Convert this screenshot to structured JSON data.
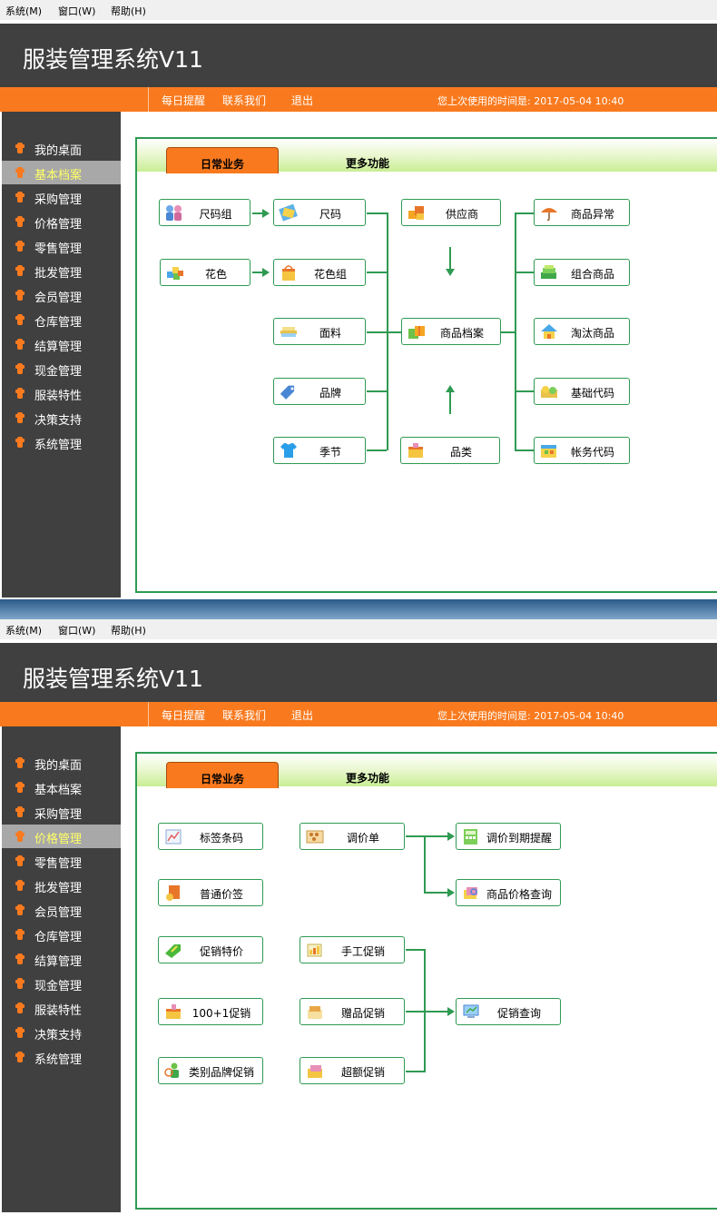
{
  "menu": {
    "system": "系统(M)",
    "window": "窗口(W)",
    "help": "帮助(H)"
  },
  "app_title": "服装管理系统V11",
  "topnav": {
    "daily_reminder": "每日提醒",
    "contact": "联系我们",
    "logout": "退出",
    "last_used": "您上次使用的时间是: 2017-05-04 10:40"
  },
  "sidebar": [
    "我的桌面",
    "基本档案",
    "采购管理",
    "价格管理",
    "零售管理",
    "批发管理",
    "会员管理",
    "仓库管理",
    "结算管理",
    "现金管理",
    "服装特性",
    "决策支持",
    "系统管理"
  ],
  "tabs": {
    "daily": "日常业务",
    "more": "更多功能"
  },
  "panel1": {
    "active_sidebar": "基本档案",
    "buttons": {
      "size_group": "尺码组",
      "size": "尺码",
      "supplier": "供应商",
      "product_abnormal": "商品异常",
      "color": "花色",
      "color_group": "花色组",
      "combo_product": "组合商品",
      "fabric": "面料",
      "product_archive": "商品档案",
      "obsolete_product": "淘汰商品",
      "brand": "品牌",
      "base_code": "基础代码",
      "season": "季节",
      "category": "品类",
      "account_code": "帐务代码"
    }
  },
  "panel2": {
    "active_sidebar": "价格管理",
    "buttons": {
      "label_barcode": "标签条码",
      "price_adjust": "调价单",
      "price_expiry": "调价到期提醒",
      "normal_price_tag": "普通价签",
      "price_query": "商品价格查询",
      "promo_special": "促销特价",
      "manual_promo": "手工促销",
      "promo_100_1": "100+1促销",
      "gift_promo": "赠品促销",
      "promo_query": "促销查询",
      "category_brand_promo": "类别品牌促销",
      "excess_promo": "超额促销"
    }
  },
  "colors": {
    "accent_orange": "#f97a1e",
    "dark_gray": "#404040",
    "green_line": "#2f9a52",
    "active_text": "#ffff66"
  }
}
